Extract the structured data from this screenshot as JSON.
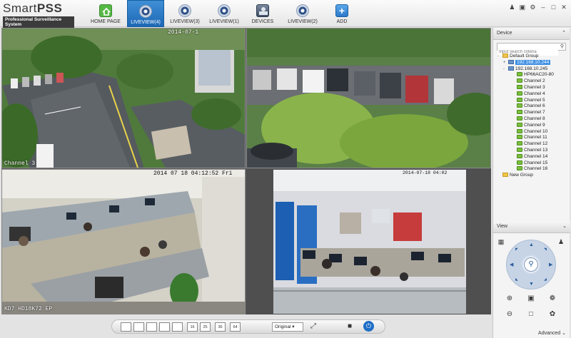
{
  "app": {
    "title_plain": "Smart",
    "title_bold": "PSS",
    "subtitle": "Professional Surveillance System"
  },
  "tabs": [
    {
      "label": "HOME PAGE",
      "icon": "home-icon",
      "active": false
    },
    {
      "label": "LIVEVIEW(4)",
      "icon": "camera-icon",
      "active": true
    },
    {
      "label": "LIVEVIEW(3)",
      "icon": "camera-icon",
      "active": false
    },
    {
      "label": "LIVEVIEW(1)",
      "icon": "camera-icon",
      "active": false
    },
    {
      "label": "DEVICES",
      "icon": "devices-icon",
      "active": false
    },
    {
      "label": "LIVEVIEW(2)",
      "icon": "camera-icon",
      "active": false
    },
    {
      "label": "ADD",
      "icon": "plus-icon",
      "active": false
    }
  ],
  "window_controls": [
    "user-icon",
    "lock-icon",
    "settings-icon",
    "minimize-icon",
    "maximize-icon",
    "close-icon"
  ],
  "video": {
    "tile1": {
      "timestamp": "2014-07-1",
      "channel": "Channel 3"
    },
    "tile3": {
      "timestamp": "2014 07 18 04:12:52 Fri",
      "camera": "KD7 HD18K72 EP"
    },
    "tile4": {
      "timestamp": "2014-07-18 04:02"
    }
  },
  "device_panel": {
    "header": "Device",
    "search_placeholder": "Input search criteria",
    "tree": [
      {
        "label": "Default Group",
        "level": 0,
        "type": "folder",
        "toggle": "-"
      },
      {
        "label": "192.168.10.244",
        "level": 1,
        "type": "dvr",
        "toggle": "+",
        "selected": true
      },
      {
        "label": "192.168.10.245",
        "level": 1,
        "type": "dvr",
        "toggle": "-"
      },
      {
        "label": "HP66AC20-80",
        "level": 2,
        "type": "channel"
      },
      {
        "label": "Channel 2",
        "level": 2,
        "type": "channel"
      },
      {
        "label": "Channel 3",
        "level": 2,
        "type": "channel"
      },
      {
        "label": "Channel 4",
        "level": 2,
        "type": "channel"
      },
      {
        "label": "Channel 5",
        "level": 2,
        "type": "channel"
      },
      {
        "label": "Channel 6",
        "level": 2,
        "type": "channel"
      },
      {
        "label": "Channel 7",
        "level": 2,
        "type": "channel"
      },
      {
        "label": "Channel 8",
        "level": 2,
        "type": "channel"
      },
      {
        "label": "Channel 9",
        "level": 2,
        "type": "channel"
      },
      {
        "label": "Channel 10",
        "level": 2,
        "type": "channel"
      },
      {
        "label": "Channel 11",
        "level": 2,
        "type": "channel"
      },
      {
        "label": "Channel 12",
        "level": 2,
        "type": "channel"
      },
      {
        "label": "Channel 13",
        "level": 2,
        "type": "channel"
      },
      {
        "label": "Channel 14",
        "level": 2,
        "type": "channel"
      },
      {
        "label": "Channel 15",
        "level": 2,
        "type": "channel"
      },
      {
        "label": "Channel 16",
        "level": 2,
        "type": "channel"
      },
      {
        "label": "New Group",
        "level": 0,
        "type": "folder",
        "toggle": ""
      }
    ]
  },
  "view_panel": {
    "header": "View",
    "advanced": "Advanced"
  },
  "toolbar": {
    "layouts": [
      "",
      "",
      "",
      "",
      "",
      "16",
      "25",
      "36",
      "64"
    ],
    "zoom_value": "Original"
  },
  "colors": {
    "accent": "#2b7bd0",
    "tab_active": "#1d68b6"
  }
}
